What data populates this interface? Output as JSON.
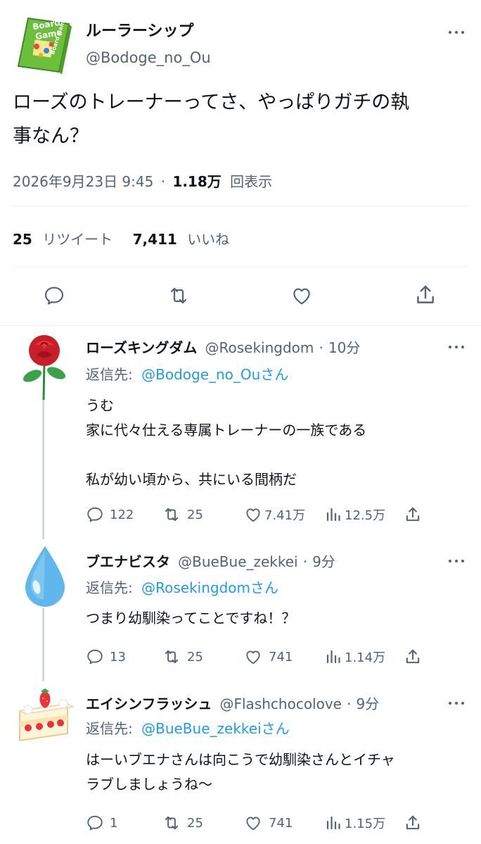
{
  "main_tweet": {
    "display_name": "ルーラーシップ",
    "handle": "@Bodoge_no_Ou",
    "avatar_text_1": "Board",
    "avatar_text_2": "Game",
    "avatar_text_3": "Board Game",
    "text_line1": "ローズのトレーナーってさ、やっぱりガチの執",
    "text_line2": "事なん？",
    "timestamp": "2026年9月23日 9:45",
    "separator": "·",
    "views": "1.18万",
    "views_label": "回表示",
    "retweets": "25",
    "retweets_label": "リツイート",
    "likes": "7,411",
    "likes_label": "いいね"
  },
  "replies": [
    {
      "display_name": "ローズキングダム",
      "handle": "@Rosekingdom",
      "sep": "·",
      "time": "10分",
      "reply_to_label": "返信先:",
      "reply_to": "@Bodoge_no_Ouさん",
      "line1": "うむ",
      "line2": "家に代々仕える専属トレーナーの一族である",
      "line3": "私が幼い頃から、共にいる間柄だ",
      "replies": "122",
      "retweets": "25",
      "likes": "7.41万",
      "views": "12.5万"
    },
    {
      "display_name": "ブエナビスタ",
      "handle": "@BueBue_zekkei",
      "sep": "·",
      "time": "9分",
      "reply_to_label": "返信先:",
      "reply_to": "@Rosekingdomさん",
      "line1": "つまり幼馴染ってことですね！？",
      "replies": "13",
      "retweets": "25",
      "likes": "741",
      "views": "1.14万"
    },
    {
      "display_name": "エイシンフラッシュ",
      "handle": "@Flashchocolove",
      "sep": "·",
      "time": "9分",
      "reply_to_label": "返信先:",
      "reply_to": "@BueBue_zekkeiさん",
      "line1": "はーいブエナさんは向こうで幼馴染さんとイチャ",
      "line2": "ラブしましょうね〜",
      "replies": "1",
      "retweets": "25",
      "likes": "741",
      "views": "1.15万"
    }
  ],
  "colors": {
    "text": "#0f1419",
    "muted": "#536471",
    "link": "#1d9bf0",
    "divider": "#eff3f4",
    "thread": "#cfd9de"
  },
  "icons": [
    "more-icon",
    "reply-icon",
    "retweet-icon",
    "like-icon",
    "share-icon",
    "views-icon"
  ]
}
